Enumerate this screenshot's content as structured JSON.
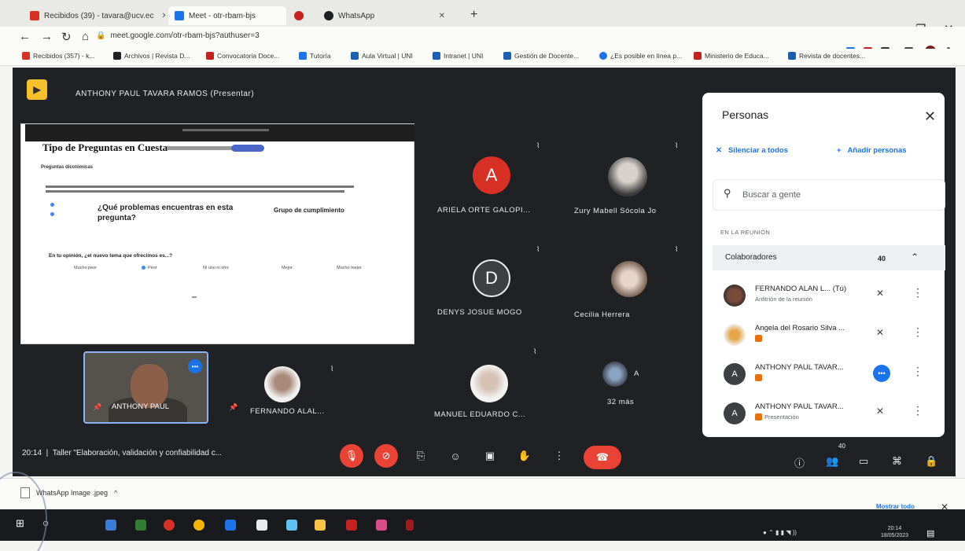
{
  "browser": {
    "tabs": [
      {
        "label": "Recibidos (39) - tavara@ucv.ec",
        "color": "#d93025"
      },
      {
        "label": "Meet - otr-rbam-bjs",
        "color": "#1a73e8"
      },
      {
        "label": "",
        "color": "#c5221f"
      },
      {
        "label": "WhatsApp",
        "color": "#202124"
      }
    ],
    "url": "meet.google.com/otr-rbam-bjs?authuser=3",
    "bookmarks": [
      {
        "label": "Recibidos (357) - k...",
        "color": "#d93025"
      },
      {
        "label": "Archivos | Revista D...",
        "color": "#202124"
      },
      {
        "label": "Convocatoria Doce...",
        "color": "#c5221f"
      },
      {
        "label": "Tutoría",
        "color": "#1a73e8"
      },
      {
        "label": "Aula Virtual | UNI",
        "color": "#1a5fb4"
      },
      {
        "label": "Intranet | UNI",
        "color": "#1a5fb4"
      },
      {
        "label": "Gestión de Docente...",
        "color": "#1a5fb4"
      },
      {
        "label": "¿Es posible en línea p...",
        "color": "#1a73e8"
      },
      {
        "label": "Ministerio de Educa...",
        "color": "#c5221f"
      },
      {
        "label": "Revista de docentes...",
        "color": "#1a5fb4"
      }
    ]
  },
  "meet": {
    "presenter": "ANTHONY PAUL TAVARA RAMOS (Presentar)",
    "slide": {
      "title": "Tipo de Preguntas en Cuesta",
      "subtitle": "Preguntas dicotómicas",
      "question": "¿Qué problemas encuentras en esta pregunta?",
      "side_label": "Grupo de cumplimiento",
      "question2": "En tu opinión, ¿el nuevo tema que ofrecimos es...?",
      "options": [
        "Mucho peor",
        "Peor",
        "Ni uno ni otro",
        "Mejor",
        "Mucho mejor"
      ]
    },
    "participants": [
      {
        "name": "ARIELA ORTE GALOPI...",
        "letter": "A",
        "color": "#d93025"
      },
      {
        "name": "Zury Mabell Sócola Jo",
        "photo": true
      },
      {
        "name": "DENYS JOSUE MOGO",
        "letter": "D",
        "color": "#3c4043"
      },
      {
        "name": "Cecilia Herrera",
        "photo": true
      },
      {
        "name": "FERNANDO ALAL...",
        "photo": true
      },
      {
        "name": "MANUEL EDUARDO C...",
        "photo": true
      },
      {
        "name": "32 más",
        "letter": "A"
      }
    ],
    "self_tile_label": "ANTHONY PAUL",
    "time": "20:14",
    "meeting_title": "Taller \"Elaboración, validación y confiabilidad c...",
    "people_count": "40"
  },
  "panel": {
    "title": "Personas",
    "mute_all": "Silenciar a todos",
    "add_people": "Añadir personas",
    "search_placeholder": "Buscar a gente",
    "section": "EN LA REUNIÓN",
    "group": "Colaboradores",
    "group_count": "40",
    "rows": [
      {
        "name": "FERNANDO ALAN L... (Tú)",
        "sub": "Anfitrión de la reunión",
        "avatar": "photo"
      },
      {
        "name": "Angela del Rosario Silva ...",
        "sub": "",
        "avatar": "photo"
      },
      {
        "name": "ANTHONY PAUL TAVAR...",
        "sub": "",
        "avatar": "A"
      },
      {
        "name": "ANTHONY PAUL TAVAR...",
        "sub": "Presentación",
        "avatar": "A"
      }
    ]
  },
  "downloads": {
    "file": "WhatsApp Image .jpeg",
    "show_all": "Mostrar todo"
  },
  "taskbar": {
    "time": "20:14",
    "date": "18/05/2023"
  }
}
